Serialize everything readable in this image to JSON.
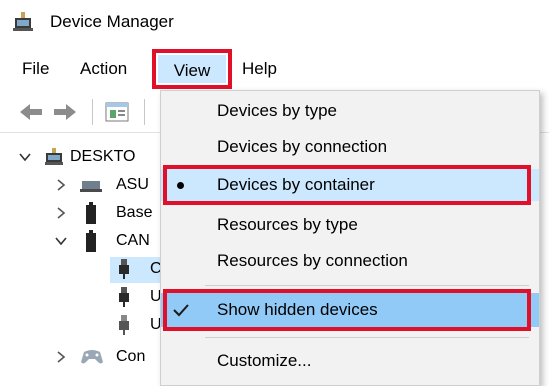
{
  "window": {
    "title": "Device Manager"
  },
  "menubar": {
    "file": "File",
    "action": "Action",
    "view": "View",
    "help": "Help"
  },
  "toolbar": {
    "icons": [
      "back-arrow-icon",
      "forward-arrow-icon",
      "properties-icon"
    ]
  },
  "tree": {
    "root": "DESKTO",
    "items": [
      {
        "label": "ASU",
        "icon": "laptop-icon"
      },
      {
        "label": "Base",
        "icon": "battery-icon"
      },
      {
        "label": "CAN",
        "icon": "device-icon"
      },
      {
        "label": "C",
        "icon": "usb-icon"
      },
      {
        "label": "U",
        "icon": "usb-icon"
      },
      {
        "label": "U",
        "icon": "usb-icon"
      },
      {
        "label": "Con",
        "icon": "game-controller-icon"
      }
    ]
  },
  "view_menu": {
    "items": [
      {
        "label": "Devices by type"
      },
      {
        "label": "Devices by connection"
      },
      {
        "label": "Devices by container",
        "selected": true
      },
      {
        "label": "Resources by type"
      },
      {
        "label": "Resources by connection"
      },
      {
        "label": "Show hidden devices",
        "checked": true
      },
      {
        "label": "Customize..."
      }
    ]
  },
  "colors": {
    "highlight_border": "#e0102a",
    "menu_hover": "#cce8ff",
    "checked_bg": "#91c9f7"
  }
}
